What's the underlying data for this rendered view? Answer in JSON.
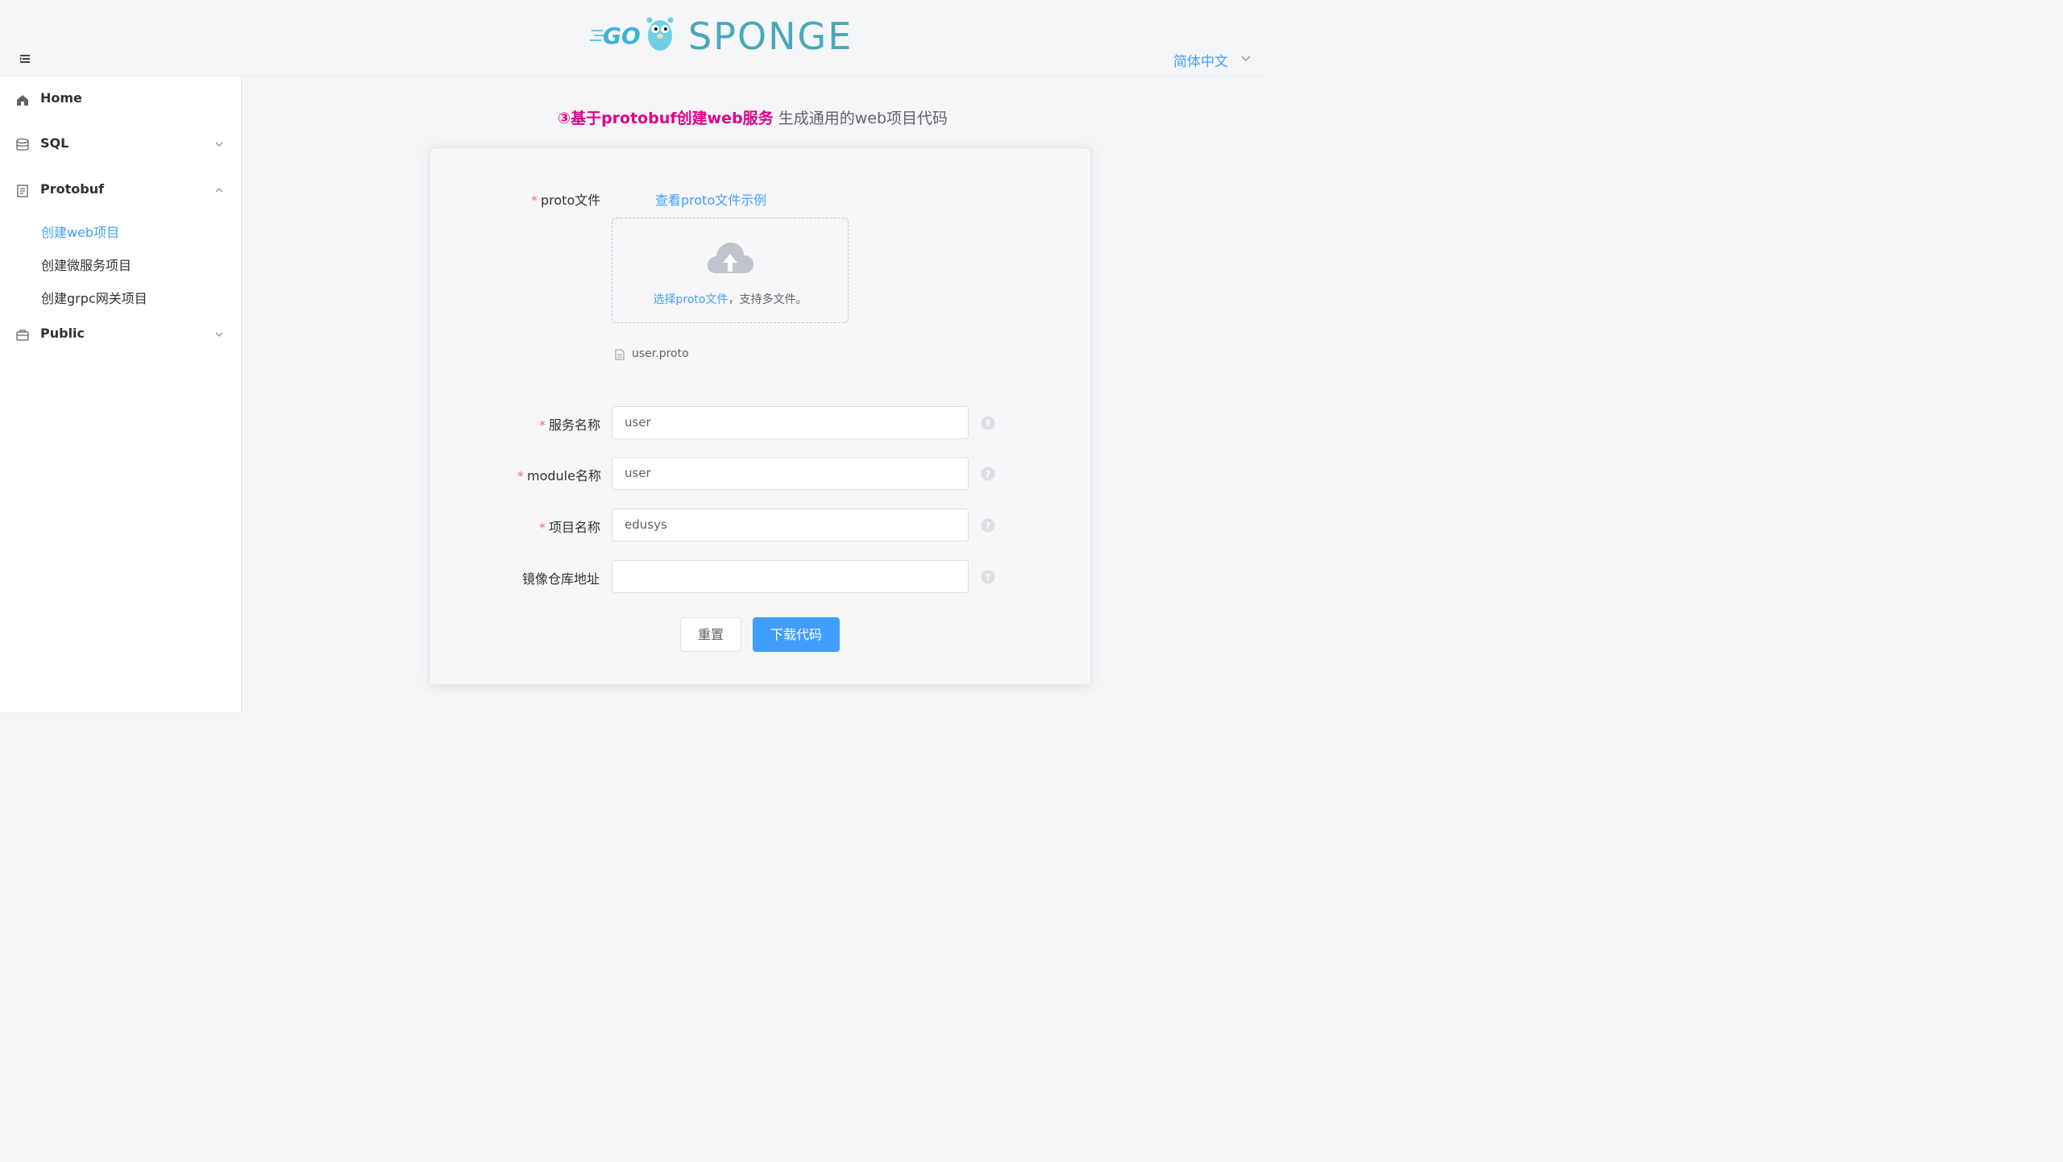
{
  "header": {
    "logo_go": "GO",
    "logo_text": "SPONGE",
    "language": "简体中文"
  },
  "sidebar": {
    "items": [
      {
        "label": "Home",
        "icon": "home-icon"
      },
      {
        "label": "SQL",
        "icon": "database-icon"
      },
      {
        "label": "Protobuf",
        "icon": "document-icon",
        "children": [
          "创建web项目",
          "创建微服务项目",
          "创建grpc网关项目"
        ],
        "active_child": "创建web项目"
      },
      {
        "label": "Public",
        "icon": "briefcase-icon"
      }
    ]
  },
  "main": {
    "title_highlight": "③基于protobuf创建web服务",
    "title_sub": " 生成通用的web项目代码",
    "form": {
      "proto_label": "proto文件",
      "proto_example_link": "查看proto文件示例",
      "upload_link_text": "选择proto文件",
      "upload_hint_text": "，支持多文件。",
      "uploaded_file": "user.proto",
      "fields": [
        {
          "label": "服务名称",
          "required": true,
          "value": "user",
          "placeholder": ""
        },
        {
          "label": "module名称",
          "required": true,
          "value": "user",
          "placeholder": ""
        },
        {
          "label": "项目名称",
          "required": true,
          "value": "edusys",
          "placeholder": ""
        },
        {
          "label": "镜像仓库地址",
          "required": false,
          "value": "",
          "placeholder": ""
        }
      ],
      "required_mark": "*",
      "reset_button": "重置",
      "download_button": "下载代码"
    }
  },
  "colors": {
    "accent": "#409eff",
    "title_highlight": "#e0008a",
    "required": "#f56c6c"
  }
}
